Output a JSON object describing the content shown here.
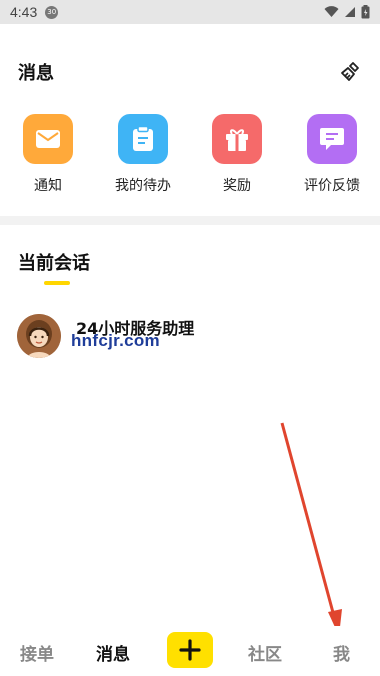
{
  "status_bar": {
    "time": "4:43",
    "notification_badge": "30"
  },
  "header": {
    "title": "消息"
  },
  "quick_actions": [
    {
      "label": "通知",
      "icon": "mail-icon",
      "color": "#ffa93a"
    },
    {
      "label": "我的待办",
      "icon": "clipboard-icon",
      "color": "#3fb4f5"
    },
    {
      "label": "奖励",
      "icon": "gift-icon",
      "color": "#f56a6a"
    },
    {
      "label": "评价反馈",
      "icon": "feedback-icon",
      "color": "#b36ef3"
    }
  ],
  "section": {
    "title": "当前会话"
  },
  "conversations": [
    {
      "name": "24小时服务助理",
      "subtitle": "hnfcjr.com"
    }
  ],
  "bottom_nav": {
    "items": [
      "接单",
      "消息",
      "社区",
      "我"
    ],
    "active": "消息",
    "plus_color": "#ffe000"
  },
  "colors": {
    "accent": "#ffd600",
    "arrow": "#e0452e"
  }
}
